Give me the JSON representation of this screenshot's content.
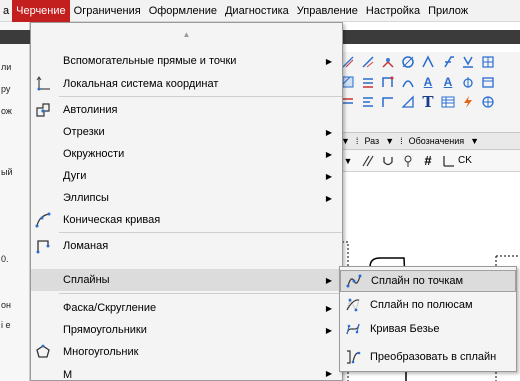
{
  "menubar": {
    "items": [
      {
        "label": "а"
      },
      {
        "label": "Черчение"
      },
      {
        "label": "Ограничения"
      },
      {
        "label": "Оформление"
      },
      {
        "label": "Диагностика"
      },
      {
        "label": "Управление"
      },
      {
        "label": "Настройка"
      },
      {
        "label": "Прилож"
      }
    ],
    "active_index": 1,
    "active_color": "#c41f1f"
  },
  "left_stub": {
    "rows": [
      "ли",
      "ру",
      "ож",
      "ый",
      "0.",
      "он",
      "і е"
    ]
  },
  "toolbar_labels": [
    "Раз",
    "Обозначения"
  ],
  "snap_ck_label": "CK",
  "dropdown": {
    "items": [
      {
        "label": "Вспомогательные прямые и точки",
        "icon": "",
        "submenu": true
      },
      {
        "label": "Локальная система координат",
        "icon": "local-coordinate-icon",
        "submenu": false
      },
      {
        "label": "Автолиния",
        "icon": "auto-line-icon",
        "submenu": false
      },
      {
        "label": "Отрезки",
        "icon": "",
        "submenu": true
      },
      {
        "label": "Окружности",
        "icon": "",
        "submenu": true
      },
      {
        "label": "Дуги",
        "icon": "",
        "submenu": true
      },
      {
        "label": "Эллипсы",
        "icon": "",
        "submenu": true
      },
      {
        "label": "Коническая кривая",
        "icon": "conic-curve-icon",
        "submenu": false
      },
      {
        "label": "Ломаная",
        "icon": "polyline-icon",
        "submenu": false
      },
      {
        "label": "Сплайны",
        "icon": "",
        "submenu": true
      },
      {
        "label": "Фаска/Скругление",
        "icon": "",
        "submenu": true
      },
      {
        "label": "Прямоугольники",
        "icon": "",
        "submenu": true
      },
      {
        "label": "Многоугольник",
        "icon": "polygon-icon",
        "submenu": false
      },
      {
        "label": "М",
        "icon": "",
        "submenu": true
      }
    ],
    "highlighted_index": 9
  },
  "submenu": {
    "items": [
      {
        "label": "Сплайн по точкам",
        "icon": "spline-points-icon"
      },
      {
        "label": "Сплайн по полюсам",
        "icon": "spline-poles-icon"
      },
      {
        "label": "Кривая Безье",
        "icon": "bezier-curve-icon"
      },
      {
        "label": "Преобразовать в сплайн",
        "icon": "convert-spline-icon"
      }
    ],
    "highlighted_index": 0
  }
}
